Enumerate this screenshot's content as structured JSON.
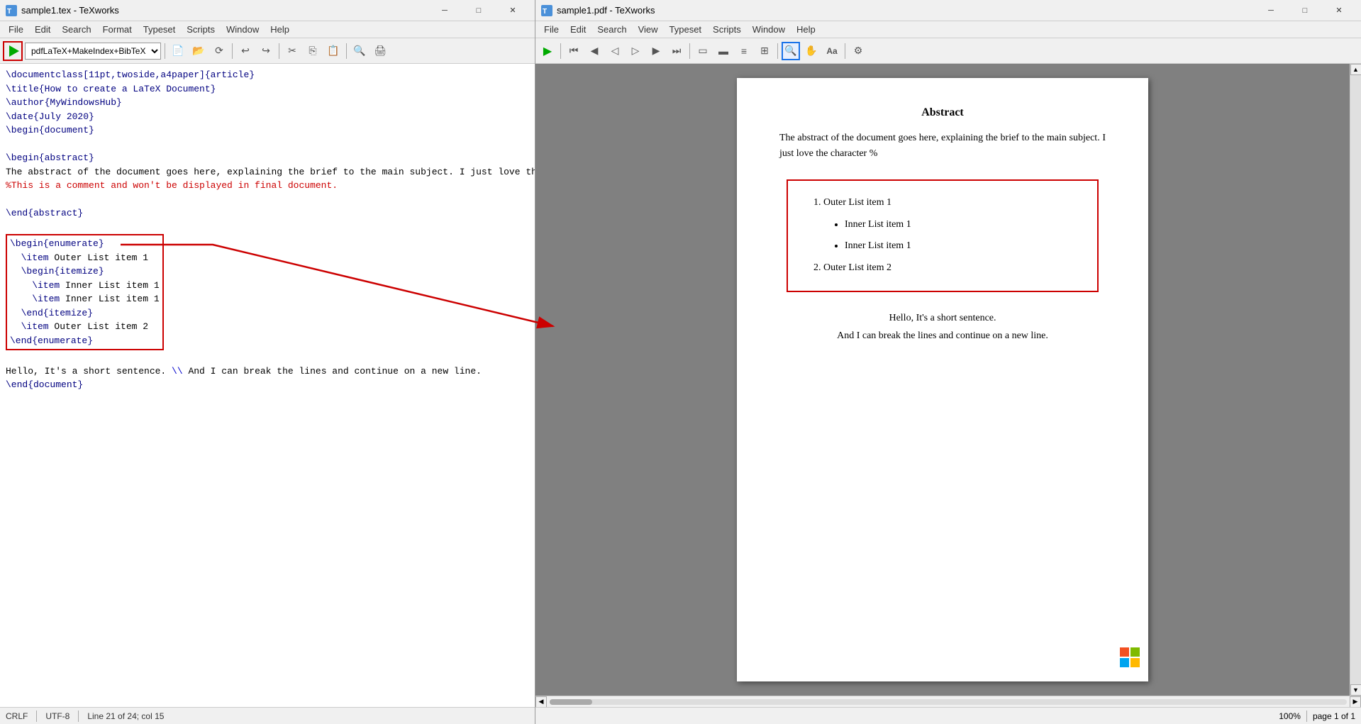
{
  "left_window": {
    "title": "sample1.tex - TeXworks",
    "menu": [
      "File",
      "Edit",
      "Search",
      "Format",
      "Typeset",
      "Scripts",
      "Window",
      "Help"
    ],
    "toolbar": {
      "compiler": "pdfLaTeX+MakeIndex+BibTeX"
    },
    "code_lines": [
      {
        "type": "cmd",
        "text": "\\documentclass[11pt,twoside,a4paper]{article}"
      },
      {
        "type": "cmd",
        "text": "\\title{How to create a LaTeX Document}"
      },
      {
        "type": "cmd",
        "text": "\\author{MyWindowsHub}"
      },
      {
        "type": "cmd",
        "text": "\\date{July 2020}"
      },
      {
        "type": "cmd",
        "text": "\\begin{document}"
      },
      {
        "type": "empty",
        "text": ""
      },
      {
        "type": "cmd",
        "text": "\\begin{abstract}"
      },
      {
        "type": "normal",
        "text": "The abstract of the document goes here, explaining the brief to the main subject. I just love the character "
      },
      {
        "type": "comment",
        "text": "%This is a comment and won't be displayed in final document."
      },
      {
        "type": "empty",
        "text": ""
      },
      {
        "type": "cmd",
        "text": "\\end{abstract}"
      },
      {
        "type": "empty",
        "text": ""
      },
      {
        "type": "cmd_selected",
        "text": "\\begin{enumerate}"
      },
      {
        "type": "cmd_selected",
        "text": "  \\item Outer List item 1"
      },
      {
        "type": "cmd_selected",
        "text": "  \\begin{itemize}"
      },
      {
        "type": "cmd_selected",
        "text": "    \\item Inner List item 1"
      },
      {
        "type": "cmd_selected",
        "text": "    \\item Inner List item 1"
      },
      {
        "type": "cmd_selected",
        "text": "  \\end{itemize}"
      },
      {
        "type": "cmd_selected",
        "text": "  \\item Outer List item 2"
      },
      {
        "type": "cmd_selected",
        "text": "\\end{enumerate}"
      },
      {
        "type": "empty",
        "text": ""
      },
      {
        "type": "normal",
        "text": "Hello, It's a short sentence. \\\\ And I can break the lines and continue on a new line."
      },
      {
        "type": "cmd",
        "text": "\\end{document}"
      }
    ],
    "status": {
      "encoding": "CRLF",
      "utf": "UTF-8",
      "position": "Line 21 of 24; col 15"
    }
  },
  "right_window": {
    "title": "sample1.pdf - TeXworks",
    "menu": [
      "File",
      "Edit",
      "Search",
      "View",
      "Typeset",
      "Scripts",
      "Window",
      "Help"
    ],
    "pdf_content": {
      "abstract_title": "Abstract",
      "abstract_text": "The abstract of the document goes here, explaining the brief to the main subject. I just love the character %",
      "outer_item_1": "Outer List item 1",
      "inner_item_1a": "Inner List item 1",
      "inner_item_1b": "Inner List item 1",
      "outer_item_2": "Outer List item 2",
      "sentence_1": "Hello, It's a short sentence.",
      "sentence_2": "And I can break the lines and continue on a new line."
    },
    "status": {
      "zoom": "100%",
      "page": "page 1 of 1"
    }
  },
  "icons": {
    "play": "▶",
    "new": "📄",
    "open": "📂",
    "reload": "🔄",
    "undo": "↩",
    "redo": "↪",
    "cut": "✂",
    "copy": "⎘",
    "paste": "📋",
    "find": "🔍",
    "print": "🖨",
    "first": "⏮",
    "prev": "◀",
    "prev2": "◁",
    "next2": "▷",
    "next": "▶",
    "next_last": "⏭",
    "page_single": "▭",
    "page_double": "▬",
    "zoom_in": "🔍",
    "hand": "✋",
    "text_select": "Aa"
  }
}
